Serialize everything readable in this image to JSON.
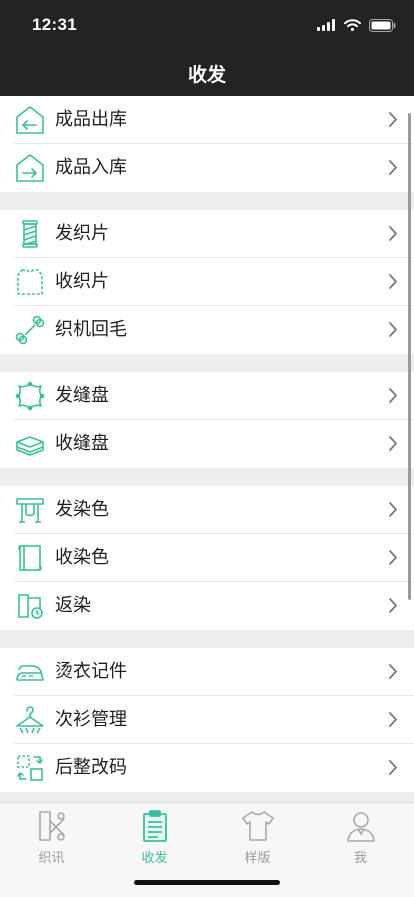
{
  "status_bar": {
    "time": "12:31"
  },
  "nav": {
    "title": "收发"
  },
  "groups": [
    {
      "items": [
        {
          "label": "成品出库",
          "icon": "warehouse-out-icon"
        },
        {
          "label": "成品入库",
          "icon": "warehouse-in-icon"
        }
      ]
    },
    {
      "items": [
        {
          "label": "发织片",
          "icon": "yarn-spool-icon"
        },
        {
          "label": "收织片",
          "icon": "knit-panel-icon"
        },
        {
          "label": "织机回毛",
          "icon": "bone-icon"
        }
      ]
    },
    {
      "items": [
        {
          "label": "发缝盘",
          "icon": "linking-disc-icon"
        },
        {
          "label": "收缝盘",
          "icon": "stacked-fabric-icon"
        }
      ]
    },
    {
      "items": [
        {
          "label": "发染色",
          "icon": "dye-rack-icon"
        },
        {
          "label": "收染色",
          "icon": "dye-frame-icon"
        },
        {
          "label": "返染",
          "icon": "redye-scroll-icon"
        }
      ]
    },
    {
      "items": [
        {
          "label": "烫衣记件",
          "icon": "iron-icon"
        },
        {
          "label": "次衫管理",
          "icon": "hanger-icon"
        },
        {
          "label": "后整改码",
          "icon": "swap-code-icon"
        }
      ]
    }
  ],
  "tabs": [
    {
      "label": "织讯",
      "icon": "scissors-icon",
      "active": false
    },
    {
      "label": "收发",
      "icon": "clipboard-icon",
      "active": true
    },
    {
      "label": "样版",
      "icon": "tshirt-icon",
      "active": false
    },
    {
      "label": "我",
      "icon": "user-icon",
      "active": false
    }
  ],
  "colors": {
    "accent": "#3bbf9b",
    "topbar": "#232324",
    "background": "#ededf0",
    "inactive": "#9c9c9c"
  }
}
